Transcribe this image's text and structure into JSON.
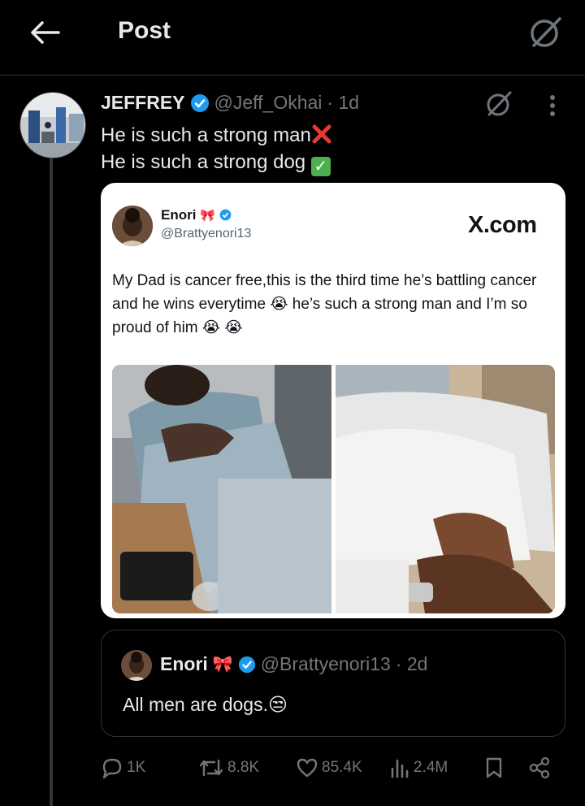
{
  "header": {
    "title": "Post",
    "back_icon": "arrow-left-icon",
    "grok_icon": "grok-icon"
  },
  "tweet": {
    "author_name": "JEFFREY",
    "handle": "@Jeff_Okhai",
    "time": "· 1d",
    "line1": "He is such a strong man",
    "line2": "He is such a strong dog",
    "accent": "#1d9bf0"
  },
  "card": {
    "name": "Enori",
    "handle": "@Brattyenori13",
    "brand": "X.com",
    "text": "My Dad is cancer free,this is the third time he’s battling cancer and he wins everytime 😭 he’s such a strong man and I’m so proud of him 😭 😭"
  },
  "quote": {
    "name": "Enori",
    "handle": "@Brattyenori13",
    "time": "· 2d",
    "text": "All men are dogs.😒"
  },
  "actions": {
    "replies": "1K",
    "reposts": "8.8K",
    "likes": "85.4K",
    "views": "2.4M"
  }
}
